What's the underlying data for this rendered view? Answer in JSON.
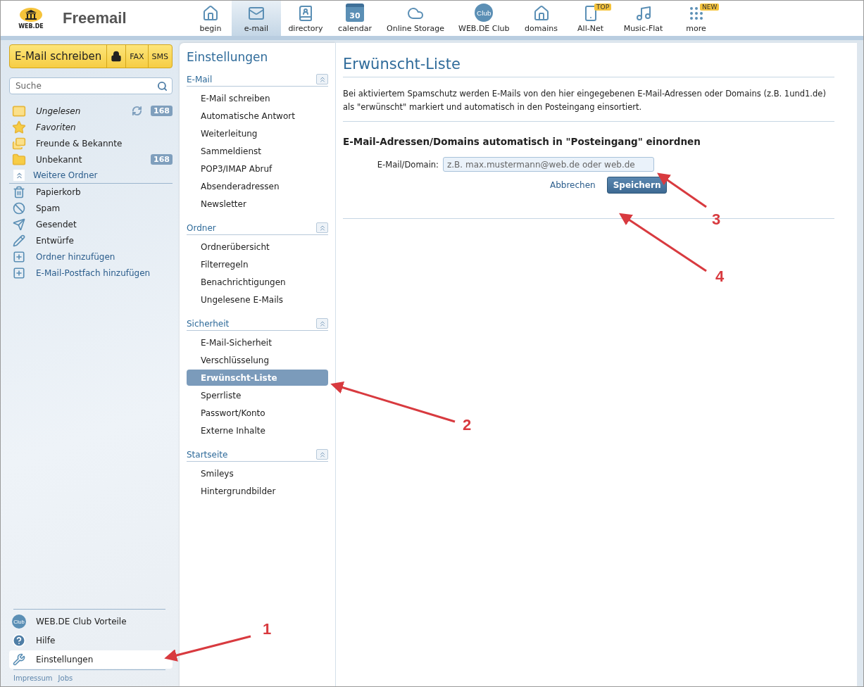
{
  "header": {
    "brand": "Freemail",
    "logo_text": "WEB.DE"
  },
  "nav": [
    {
      "label": "begin",
      "selected": false
    },
    {
      "label": "e-mail",
      "selected": true
    },
    {
      "label": "directory",
      "selected": false
    },
    {
      "icon_text": "30",
      "label": "calendar",
      "selected": false
    },
    {
      "label": "Online Storage",
      "selected": false
    },
    {
      "icon_text": "Club",
      "label": "WEB.DE Club",
      "selected": false
    },
    {
      "label": "domains",
      "selected": false
    },
    {
      "label": "All-Net",
      "badge": "TOP",
      "selected": false
    },
    {
      "label": "Music-Flat",
      "selected": false
    },
    {
      "label": "more",
      "badge": "NEW",
      "selected": false
    }
  ],
  "compose": {
    "label": "E-Mail schreiben",
    "extras": [
      "FAX",
      "SMS"
    ]
  },
  "search": {
    "placeholder": "Suche"
  },
  "folders": [
    {
      "label": "Ungelesen",
      "italic": true,
      "refresh": true,
      "count": "168"
    },
    {
      "label": "Favoriten",
      "italic": true,
      "refresh": false
    },
    {
      "label": "Freunde & Bekannte",
      "italic": false,
      "refresh": false
    },
    {
      "label": "Unbekannt",
      "italic": false,
      "refresh": false,
      "count": "168"
    }
  ],
  "more_folders": {
    "label": "Weitere Ordner",
    "expanded": true,
    "items": [
      {
        "label": "Papierkorb",
        "kind": "folder"
      },
      {
        "label": "Spam",
        "kind": "folder"
      },
      {
        "label": "Gesendet",
        "kind": "folder"
      },
      {
        "label": "Entwürfe",
        "kind": "folder"
      },
      {
        "label": "Ordner hinzufügen",
        "kind": "link"
      },
      {
        "label": "E-Mail-Postfach hinzufügen",
        "kind": "link"
      }
    ]
  },
  "bottom_menu": [
    {
      "icon_text": "Club",
      "label": "WEB.DE Club Vorteile",
      "selected": false
    },
    {
      "label": "Hilfe",
      "selected": false
    },
    {
      "label": "Einstellungen",
      "selected": true
    }
  ],
  "footer_links": [
    "Impressum",
    "Jobs"
  ],
  "settings": {
    "title": "Einstellungen",
    "sections": [
      {
        "title": "E-Mail",
        "expanded": true,
        "items": [
          {
            "label": "E-Mail schreiben",
            "selected": false
          },
          {
            "label": "Automatische Antwort",
            "selected": false
          },
          {
            "label": "Weiterleitung",
            "selected": false
          },
          {
            "label": "Sammeldienst",
            "selected": false
          },
          {
            "label": "POP3/IMAP Abruf",
            "selected": false
          },
          {
            "label": "Absenderadressen",
            "selected": false
          },
          {
            "label": "Newsletter",
            "selected": false
          }
        ]
      },
      {
        "title": "Ordner",
        "expanded": true,
        "items": [
          {
            "label": "Ordnerübersicht",
            "selected": false
          },
          {
            "label": "Filterregeln",
            "selected": false
          },
          {
            "label": "Benachrichtigungen",
            "selected": false
          },
          {
            "label": "Ungelesene E-Mails",
            "selected": false
          }
        ]
      },
      {
        "title": "Sicherheit",
        "expanded": true,
        "items": [
          {
            "label": "E-Mail-Sicherheit",
            "selected": false
          },
          {
            "label": "Verschlüsselung",
            "selected": false
          },
          {
            "label": "Erwünscht-Liste",
            "selected": true
          },
          {
            "label": "Sperrliste",
            "selected": false
          },
          {
            "label": "Passwort/Konto",
            "selected": false
          },
          {
            "label": "Externe Inhalte",
            "selected": false
          }
        ]
      },
      {
        "title": "Startseite",
        "expanded": true,
        "items": [
          {
            "label": "Smileys",
            "selected": false
          },
          {
            "label": "Hintergrundbilder",
            "selected": false
          }
        ]
      }
    ]
  },
  "content": {
    "title": "Erwünscht-Liste",
    "description": "Bei aktiviertem Spamschutz werden E-Mails von den hier eingegebenen E-Mail-Adressen oder Domains (z.B. 1und1.de) als \"erwünscht\" markiert und automatisch in den Posteingang einsortiert.",
    "subheading": "E-Mail-Adressen/Domains automatisch in \"Posteingang\" einordnen",
    "field": {
      "label": "E-Mail/Domain:",
      "placeholder": "z.B. max.mustermann@web.de oder web.de"
    },
    "cancel": "Abbrechen",
    "save": "Speichern"
  },
  "annotations": [
    {
      "label": "1"
    },
    {
      "label": "2"
    },
    {
      "label": "3"
    },
    {
      "label": "4"
    }
  ]
}
